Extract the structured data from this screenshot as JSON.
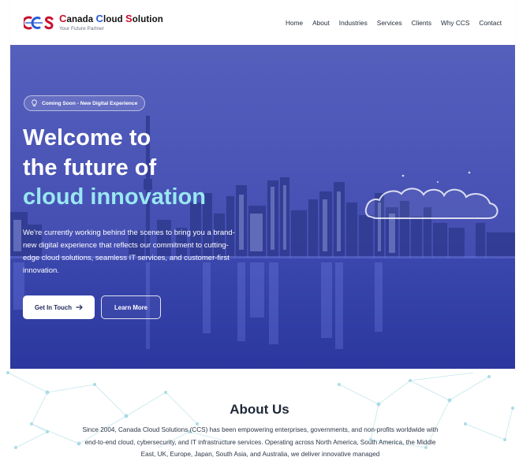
{
  "header": {
    "logo_mark": "CCS",
    "brand_parts": [
      "C",
      "anada ",
      "C",
      "loud ",
      "S",
      "olution"
    ],
    "tagline": "Your Future Partner",
    "nav": [
      "Home",
      "About",
      "Industries",
      "Services",
      "Clients",
      "Why CCS",
      "Contact"
    ]
  },
  "hero": {
    "badge": "Coming Soon - New Digital Experience",
    "badge_icon": "lightbulb-icon",
    "headline_line1": "Welcome to",
    "headline_line2": "the future of",
    "headline_line3": "cloud innovation",
    "description": "We're currently working behind the scenes to bring you a brand-new digital experience that reflects our commitment to cutting-edge cloud solutions, seamless IT services, and customer-first innovation.",
    "primary_button": "Get In Touch",
    "primary_button_icon": "arrow-right-icon",
    "secondary_button": "Learn More",
    "decoration_icon": "cloud-icon"
  },
  "about": {
    "title": "About Us",
    "text": "Since 2004, Canada Cloud Solutions (CCS) has been empowering enterprises, governments, and non-profits worldwide with end-to-end cloud, cybersecurity, and IT infrastructure services. Operating across North America, South America, the Middle East, UK, Europe, Japan, South Asia, and Australia, we deliver innovative managed"
  },
  "colors": {
    "brand_red": "#c8102e",
    "brand_blue": "#2a5bd7",
    "hero_overlay": "#3d4cb0",
    "accent_cyan": "#9ae7f2"
  }
}
